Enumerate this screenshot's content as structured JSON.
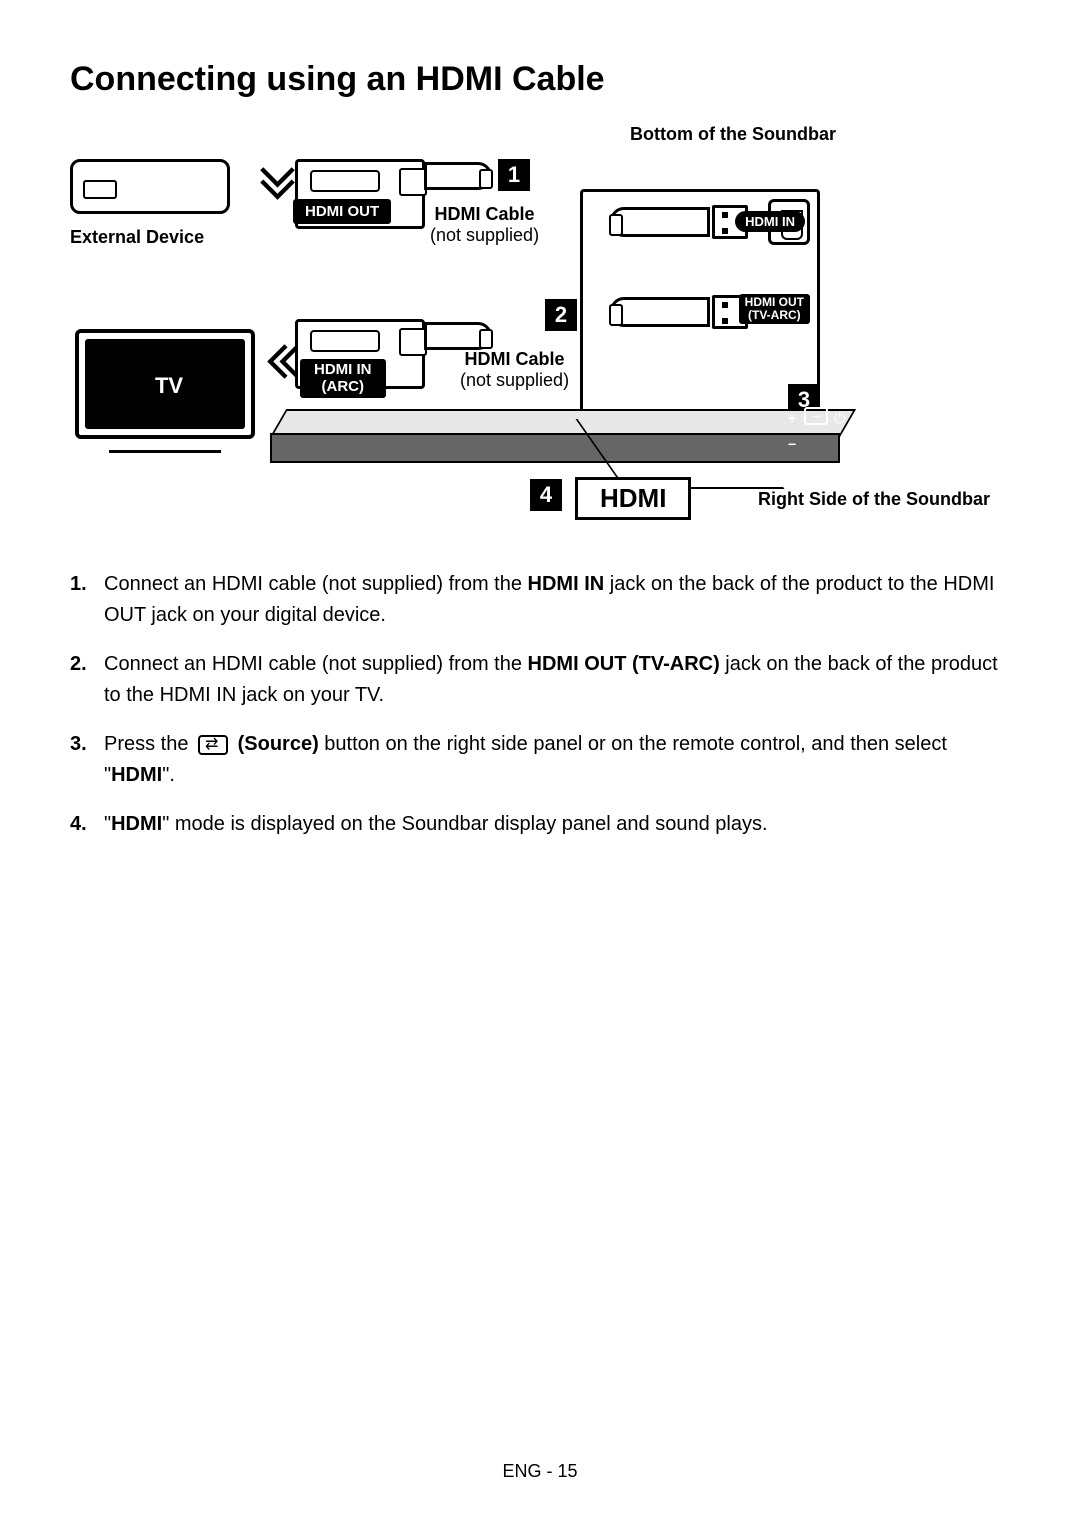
{
  "title": "Connecting using an HDMI Cable",
  "diagram": {
    "bottom_label": "Bottom of the Soundbar",
    "external_device": "External Device",
    "hdmi_out": "HDMI OUT",
    "hdmi_cable": "HDMI Cable",
    "not_supplied": "(not supplied)",
    "hdmi_in_port": "HDMI IN",
    "hdmi_out_tvarc_port": "HDMI OUT\n(TV-ARC)",
    "tv": "TV",
    "hdmi_in_arc": "HDMI IN\n(ARC)",
    "hdmi_display": "HDMI",
    "right_side": "Right Side of the Soundbar",
    "n1": "1",
    "n2": "2",
    "n3": "3",
    "n4": "4"
  },
  "steps": {
    "s1n": "1.",
    "s1a": "Connect an HDMI cable (not supplied) from the ",
    "s1b": "HDMI IN",
    "s1c": " jack on the back of the product to the HDMI OUT jack on your digital device.",
    "s2n": "2.",
    "s2a": "Connect an HDMI cable (not supplied) from the ",
    "s2b": "HDMI OUT (TV-ARC)",
    "s2c": " jack on the back of the product to the HDMI IN jack on your TV.",
    "s3n": "3.",
    "s3a": "Press the ",
    "s3b": " (Source)",
    "s3c": " button on the right side panel or on the remote control, and then select \"",
    "s3d": "HDMI",
    "s3e": "\".",
    "s4n": "4.",
    "s4a": "\"",
    "s4b": "HDMI",
    "s4c": "\" mode is displayed on the Soundbar display panel and sound plays."
  },
  "footer": "ENG - 15"
}
